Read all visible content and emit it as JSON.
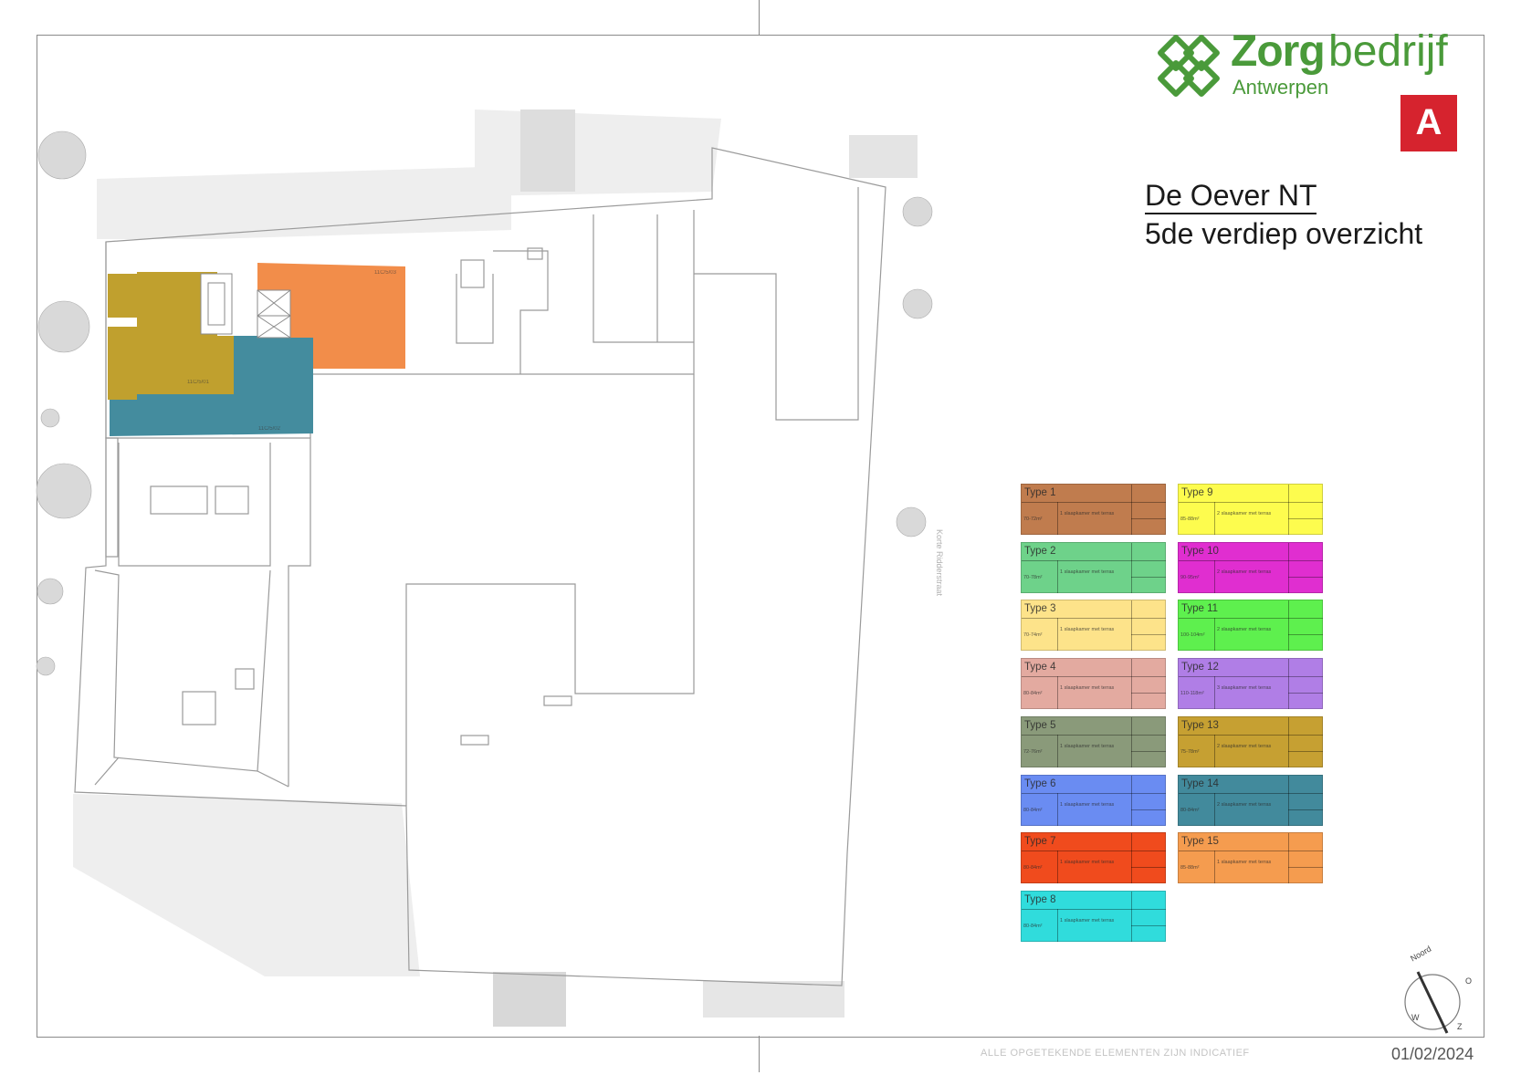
{
  "header": {
    "logo_word1": "Zorg",
    "logo_word2": "bedrijf",
    "logo_sub": "Antwerpen",
    "city_logo_letter": "A"
  },
  "title": {
    "project": "De Oever NT",
    "subtitle": "5de verdiep overzicht"
  },
  "plan": {
    "street_name": "Korte Ridderstraat",
    "units": [
      {
        "label": "11C/5/01",
        "color": "#c0a02e"
      },
      {
        "label": "11C/5/02",
        "color": "#448c9e"
      },
      {
        "label": "11C/5/03",
        "color": "#f28d4a"
      }
    ]
  },
  "legend": {
    "column_left": [
      {
        "name": "Type 1",
        "area": "70-72m²",
        "desc": "1 slaapkamer met terras",
        "color": "#c07c4e"
      },
      {
        "name": "Type 2",
        "area": "70-78m²",
        "desc": "1 slaapkamer met terras",
        "color": "#6ed28a"
      },
      {
        "name": "Type 3",
        "area": "70-74m²",
        "desc": "1 slaapkamer met terras",
        "color": "#fde38a"
      },
      {
        "name": "Type 4",
        "area": "80-84m²",
        "desc": "1 slaapkamer met terras",
        "color": "#e3aaa0"
      },
      {
        "name": "Type 5",
        "area": "72-76m²",
        "desc": "1 slaapkamer met terras",
        "color": "#8a9a7a"
      },
      {
        "name": "Type 6",
        "area": "80-84m²",
        "desc": "1 slaapkamer met terras",
        "color": "#6a8cf2"
      },
      {
        "name": "Type 7",
        "area": "80-84m²",
        "desc": "1 slaapkamer met terras",
        "color": "#f04b1d"
      },
      {
        "name": "Type 8",
        "area": "80-84m²",
        "desc": "1 slaapkamer met terras",
        "color": "#30dcdc"
      }
    ],
    "column_right": [
      {
        "name": "Type 9",
        "area": "85-88m²",
        "desc": "2 slaapkamer met terras",
        "color": "#fdfc4e"
      },
      {
        "name": "Type 10",
        "area": "90-95m²",
        "desc": "2 slaapkamer met terras",
        "color": "#e02ed0"
      },
      {
        "name": "Type 11",
        "area": "100-104m²",
        "desc": "2 slaapkamer met terras",
        "color": "#5ef04e"
      },
      {
        "name": "Type 12",
        "area": "110-118m²",
        "desc": "3 slaapkamer met terras",
        "color": "#b07ee6"
      },
      {
        "name": "Type 13",
        "area": "75-78m²",
        "desc": "2 slaapkamer met terras",
        "color": "#c6a032"
      },
      {
        "name": "Type 14",
        "area": "80-84m²",
        "desc": "2 slaapkamer met terras",
        "color": "#428a9c"
      },
      {
        "name": "Type 15",
        "area": "85-88m²",
        "desc": "1 slaapkamer met terras",
        "color": "#f59c4f"
      }
    ]
  },
  "compass": {
    "north": "Noord",
    "east": "O",
    "south": "Z",
    "west": "W"
  },
  "footer": {
    "note": "ALLE OPGETEKENDE ELEMENTEN ZIJN INDICATIEF",
    "date": "01/02/2024"
  }
}
